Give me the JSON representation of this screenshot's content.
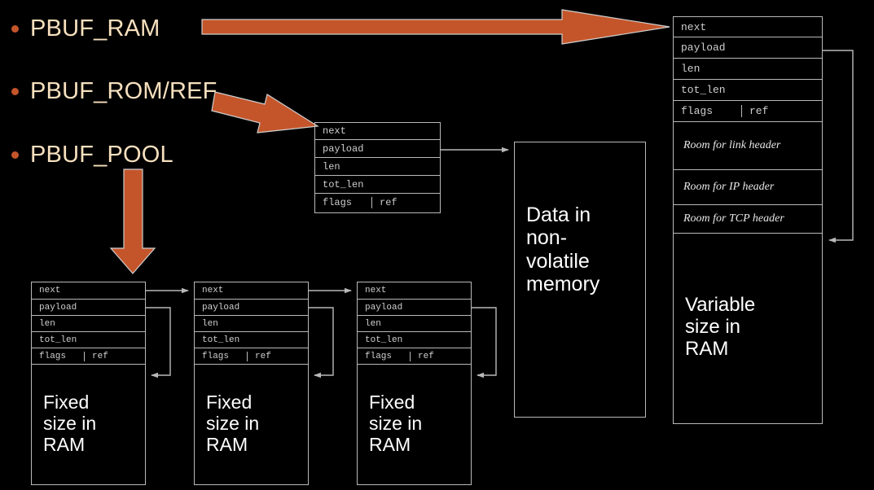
{
  "slide": {
    "background": "#000000",
    "accent_orange": "#C4552A",
    "bullet_text_color": "#F7E0BE",
    "box_line_color": "#B9B9B9",
    "label_text_color": "#FFFFFF"
  },
  "bullets": [
    {
      "label": "PBUF_RAM"
    },
    {
      "label": "PBUF_ROM/REF"
    },
    {
      "label": "PBUF_POOL"
    }
  ],
  "pbuf_fields": {
    "next": "next",
    "payload": "payload",
    "len": "len",
    "tot_len": "tot_len",
    "flags": "flags",
    "ref": "ref"
  },
  "ram_pbuf": {
    "rows": [
      "next",
      "payload",
      "len",
      "tot_len"
    ],
    "flags": "flags",
    "ref": "ref",
    "rooms": [
      "Room for link header",
      "Room for IP header",
      "Room for TCP header"
    ],
    "data_label": "Variable size in RAM"
  },
  "rom_pbuf": {
    "rows": [
      "next",
      "payload",
      "len",
      "tot_len"
    ],
    "flags": "flags",
    "ref": "ref"
  },
  "nonvolatile_box": {
    "label": "Data in non-volatile memory"
  },
  "pool_pbufs": [
    {
      "rows": [
        "next",
        "payload",
        "len",
        "tot_len"
      ],
      "flags": "flags",
      "ref": "ref",
      "data_label": "Fixed size in RAM"
    },
    {
      "rows": [
        "next",
        "payload",
        "len",
        "tot_len"
      ],
      "flags": "flags",
      "ref": "ref",
      "data_label": "Fixed size in RAM"
    },
    {
      "rows": [
        "next",
        "payload",
        "len",
        "tot_len"
      ],
      "flags": "flags",
      "ref": "ref",
      "data_label": "Fixed size in RAM"
    }
  ],
  "arrows": {
    "ram_arrow": "right-arrow-to-ram-pbuf",
    "rom_arrow": "diagonal-arrow-to-rom-pbuf",
    "pool_arrow": "down-arrow-to-pool-chain"
  }
}
